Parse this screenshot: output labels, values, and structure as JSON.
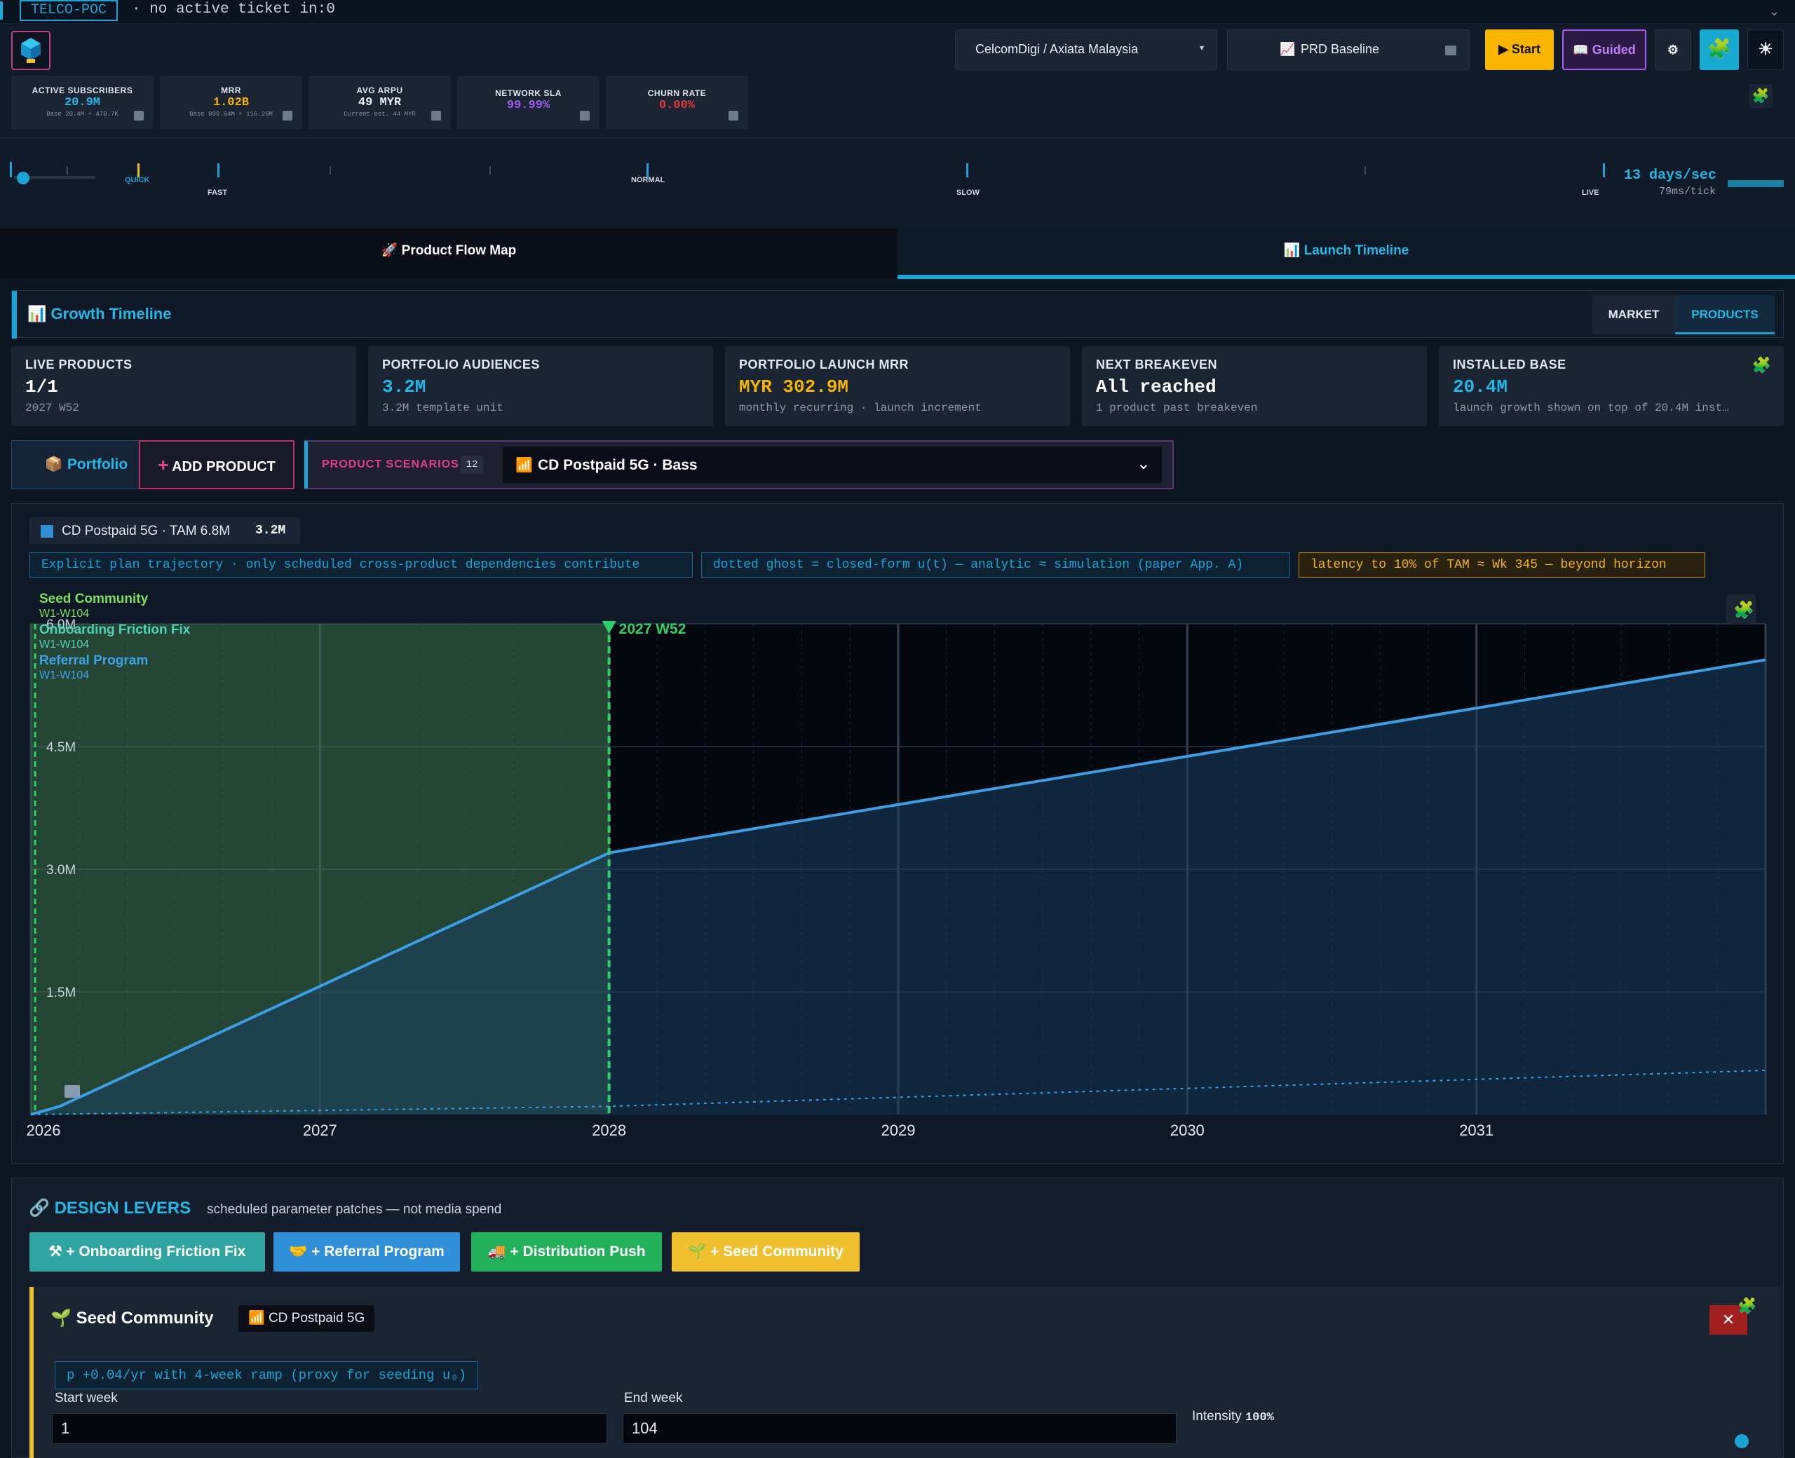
{
  "topbar": {
    "tag": "TELCO-POC",
    "ticket": "· no active ticket in:0"
  },
  "header": {
    "kpis": [
      {
        "label": "ACTIVE SUBSCRIBERS",
        "value": "20.9M",
        "sub": "Base 20.4M + 470.7K",
        "color": "#22b8e6"
      },
      {
        "label": "MRR",
        "value": "1.02B",
        "sub": "Base 899.64M + 116.26M",
        "color": "#f4b400"
      },
      {
        "label": "AVG ARPU",
        "value": "49 MYR",
        "sub": "Current est. 44 MYR",
        "color": "#e8edf3"
      },
      {
        "label": "NETWORK SLA",
        "value": "99.99%",
        "sub": "",
        "color": "#a45df0"
      },
      {
        "label": "CHURN RATE",
        "value": "0.00%",
        "sub": "",
        "color": "#e23a3a"
      }
    ],
    "operator_select": "CelcomDigi / Axiata Malaysia",
    "baseline_select": "PRD Baseline",
    "start_label": "Start",
    "guided_label": "Guided"
  },
  "speed": {
    "labels": {
      "quick": "QUICK",
      "fast": "FAST",
      "normal": "NORMAL",
      "slow": "SLOW",
      "live": "LIVE"
    },
    "rate": "13 days/sec",
    "tick": "79ms/tick"
  },
  "tabs": [
    {
      "label": "Product Flow Map"
    },
    {
      "label": "Launch Timeline"
    }
  ],
  "growth": {
    "title": "Growth Timeline",
    "toggle": [
      "MARKET",
      "PRODUCTS"
    ],
    "stats": [
      {
        "label": "LIVE PRODUCTS",
        "value": "1/1",
        "sub": "2027 W52",
        "color": "#ffffff"
      },
      {
        "label": "PORTFOLIO AUDIENCES",
        "value": "3.2M",
        "sub": "3.2M template unit",
        "color": "#22b8e6"
      },
      {
        "label": "PORTFOLIO LAUNCH MRR",
        "value": "MYR 302.9M",
        "sub": "monthly recurring · launch increment",
        "color": "#f4b400"
      },
      {
        "label": "NEXT BREAKEVEN",
        "value": "All reached",
        "sub": "1 product past breakeven",
        "color": "#ffffff"
      },
      {
        "label": "INSTALLED BASE",
        "value": "20.4M",
        "sub": "launch growth shown on top of 20.4M inst…",
        "color": "#22b8e6"
      }
    ],
    "portfolio_label": "Portfolio",
    "add_product_label": "ADD PRODUCT",
    "scenarios_label": "PRODUCT SCENARIOS",
    "scenarios_count": "12",
    "scenario_selected": "CD Postpaid 5G · Bass",
    "legend_label": "CD Postpaid 5G · TAM 6.8M",
    "legend_value": "3.2M",
    "notes": [
      "Explicit plan trajectory · only scheduled cross-product dependencies contribute",
      "dotted ghost = closed-form u(t) — analytic ≈ simulation (paper App. A)",
      "latency to 10% of TAM ≈ Wk 345 — beyond horizon"
    ]
  },
  "chart_data": {
    "type": "area",
    "x_ticks": [
      "2026",
      "2027",
      "2028",
      "2029",
      "2030",
      "2031"
    ],
    "y_ticks": [
      "1.5M",
      "3.0M",
      "4.5M",
      "6.0M"
    ],
    "ylim": [
      0,
      6000000
    ],
    "xlim": [
      2026.0,
      2032.0
    ],
    "marker_label": "2027 W52",
    "marker_x": 2028.0,
    "series": [
      {
        "values_x": [
          2026.0,
          2026.1,
          2028.0,
          2032.0
        ],
        "values_y": [
          0,
          100000,
          3200000,
          5560000
        ],
        "color": "#3b9fe6"
      },
      {
        "values_x": [
          2026.0,
          2028.0,
          2032.0
        ],
        "values_y": [
          0,
          100000,
          540000
        ],
        "color": "#3b9fe6",
        "dotted": true
      }
    ],
    "interventions": [
      {
        "name": "Seed Community",
        "range": "W1-W104",
        "color": "#7ee05b"
      },
      {
        "name": "Onboarding Friction Fix",
        "range": "W1-W104",
        "color": "#4fd1b8"
      },
      {
        "name": "Referral Program",
        "range": "W1-W104",
        "color": "#3ba4e8"
      }
    ]
  },
  "levers": {
    "title": "DESIGN LEVERS",
    "subtitle": "scheduled parameter patches — not media spend",
    "buttons": [
      {
        "label": "+ Onboarding Friction Fix",
        "color": "#2fa4a0"
      },
      {
        "label": "+ Referral Program",
        "color": "#2f8fd8"
      },
      {
        "label": "+ Distribution Push",
        "color": "#23b05a"
      },
      {
        "label": "+ Seed Community",
        "color": "#f0c030"
      }
    ],
    "card": {
      "title": "Seed Community",
      "product": "CD Postpaid 5G",
      "formula": "p +0.04/yr with 4-week ramp (proxy for seeding u₀)",
      "start_label": "Start week",
      "start_value": "1",
      "end_label": "End week",
      "end_value": "104",
      "intensity_label": "Intensity",
      "intensity_value": "100%"
    }
  }
}
